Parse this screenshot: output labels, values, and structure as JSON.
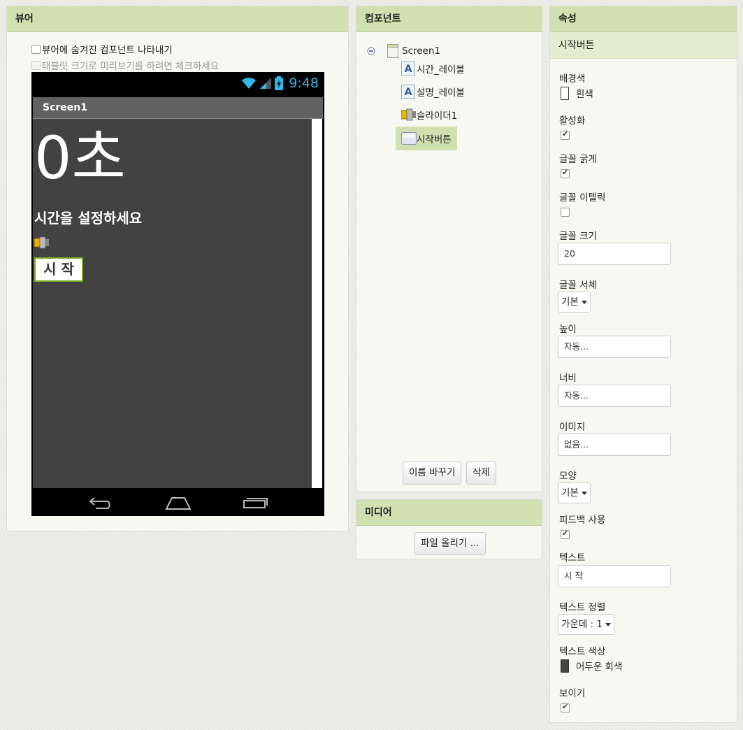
{
  "viewer": {
    "title": "뷰어",
    "show_hidden_label": "뷰어에 숨겨진 컴포넌트 나타내기",
    "tablet_preview_label": "태블릿 크기로 미리보기를 하려면 체크하세요"
  },
  "phone": {
    "clock": "9:48",
    "screen_title": "Screen1",
    "time_label": "0초",
    "desc_label": "시간을 설정하세요",
    "start_button": "시 작"
  },
  "components": {
    "title": "컴포넌트",
    "tree": [
      {
        "label": "Screen1",
        "icon": "screen-icon"
      },
      {
        "label": "시간_레이블",
        "icon": "label-icon"
      },
      {
        "label": "설명_레이블",
        "icon": "label-icon"
      },
      {
        "label": "슬라이더1",
        "icon": "slider-icon"
      },
      {
        "label": "시작버튼",
        "icon": "button-icon",
        "selected": true
      }
    ],
    "rename_button": "이름 바꾸기",
    "delete_button": "삭제"
  },
  "media": {
    "title": "미디어",
    "upload_button": "파일 올리기 ..."
  },
  "properties": {
    "title": "속성",
    "component_name": "시작버튼",
    "background_color": {
      "label": "배경색",
      "value": "흰색",
      "swatch": "#ffffff"
    },
    "enabled": {
      "label": "활성화",
      "checked": true
    },
    "font_bold": {
      "label": "글꼴 굵게",
      "checked": true
    },
    "font_italic": {
      "label": "글꼴 이텔릭",
      "checked": false
    },
    "font_size": {
      "label": "글꼴 크기",
      "value": "20"
    },
    "font_typeface": {
      "label": "글꼴 서체",
      "value": "기본"
    },
    "height": {
      "label": "높이",
      "value": "자동..."
    },
    "width": {
      "label": "너비",
      "value": "자동..."
    },
    "image": {
      "label": "이미지",
      "value": "없음..."
    },
    "shape": {
      "label": "모양",
      "value": "기본"
    },
    "feedback": {
      "label": "피드백 사용",
      "checked": true
    },
    "text": {
      "label": "텍스트",
      "value": "시 작"
    },
    "text_alignment": {
      "label": "텍스트 정렬",
      "value": "가운데 : 1"
    },
    "text_color": {
      "label": "텍스트 색상",
      "value": "어두운 회색",
      "swatch": "#444444"
    },
    "visible": {
      "label": "보이기",
      "checked": true
    }
  },
  "colors": {
    "header_bg": "#d1e0b1",
    "panel_bg": "#f8f8f2",
    "clock_blue": "#33b5e5",
    "button_border": "#7cad2b",
    "phone_screen": "#424242"
  }
}
